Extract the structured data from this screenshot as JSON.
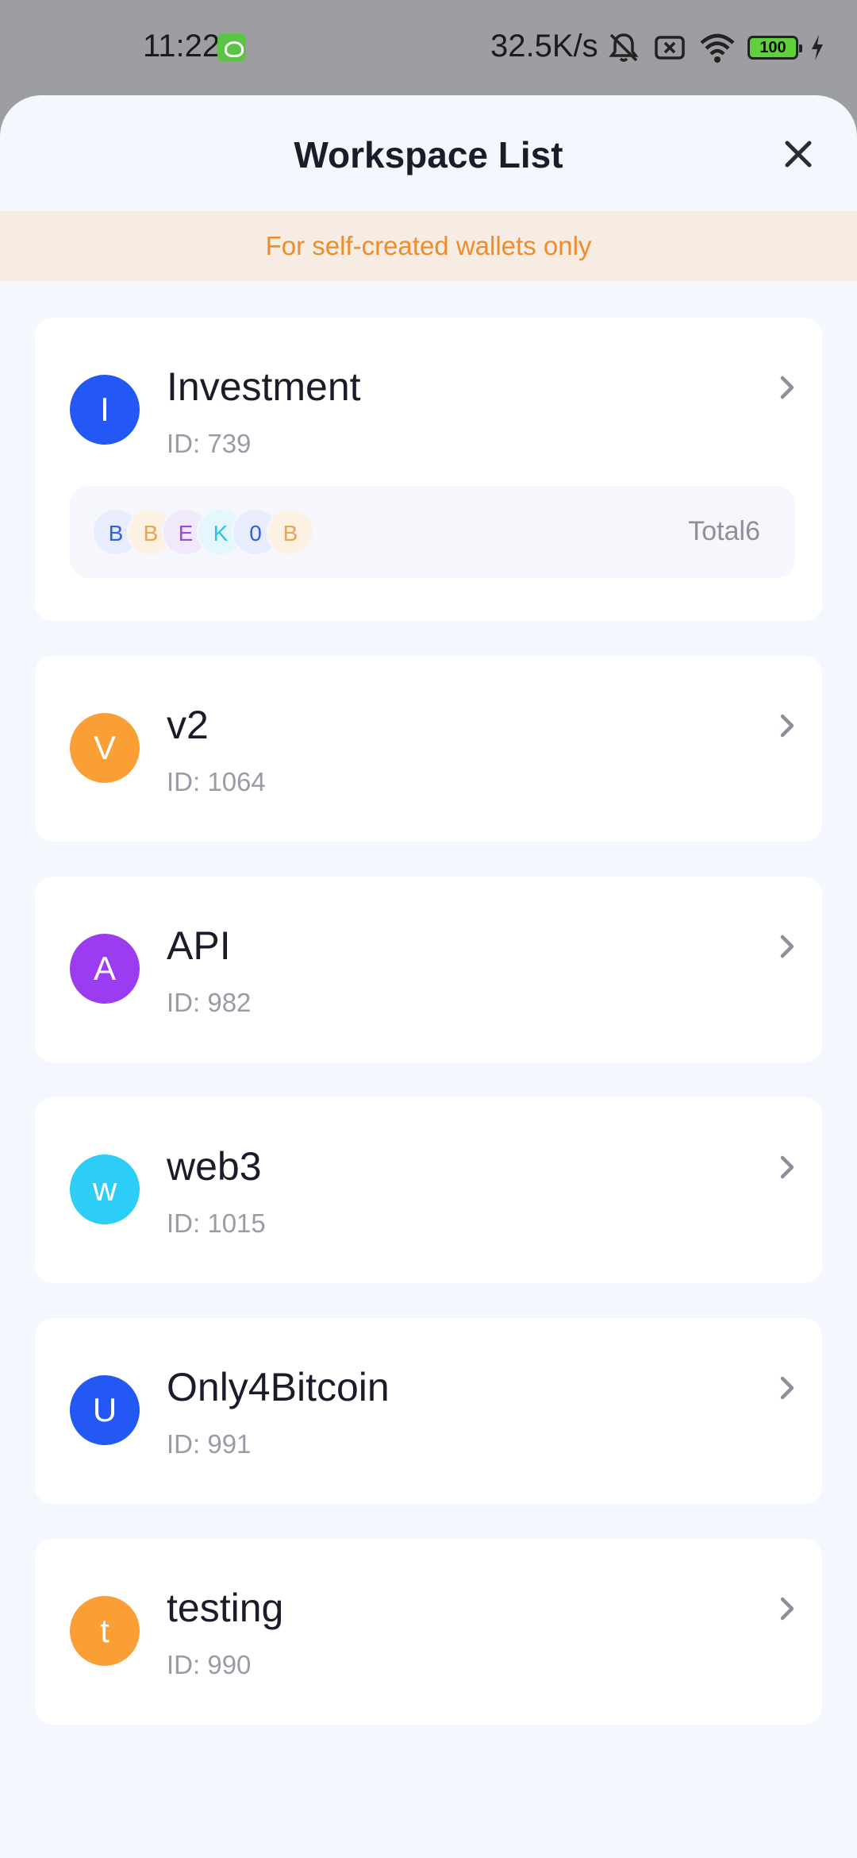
{
  "status_bar": {
    "time": "11:22",
    "speed": "32.5K/s",
    "battery": "100"
  },
  "sheet": {
    "title": "Workspace List",
    "notice": "For self-created wallets only"
  },
  "workspaces": [
    {
      "initial": "I",
      "name": "Investment",
      "id": "ID: 739",
      "color": "#2458f4",
      "wallets": {
        "coins": [
          {
            "letter": "B",
            "fg": "#2e5fe6",
            "bg": "#e7edfc"
          },
          {
            "letter": "B",
            "fg": "#f0a24a",
            "bg": "#fdf1e4"
          },
          {
            "letter": "E",
            "fg": "#9b4ad9",
            "bg": "#f1e8fb"
          },
          {
            "letter": "K",
            "fg": "#2cc4e6",
            "bg": "#e4f7fc"
          },
          {
            "letter": "0",
            "fg": "#2e5fe6",
            "bg": "#e7edfc"
          },
          {
            "letter": "B",
            "fg": "#f0a24a",
            "bg": "#fdf1e4"
          }
        ],
        "total": "Total6"
      }
    },
    {
      "initial": "V",
      "name": "v2",
      "id": "ID: 1064",
      "color": "#fa9e36"
    },
    {
      "initial": "A",
      "name": "API",
      "id": "ID: 982",
      "color": "#9b3cf0"
    },
    {
      "initial": "w",
      "name": "web3",
      "id": "ID: 1015",
      "color": "#2ccdf7"
    },
    {
      "initial": "U",
      "name": "Only4Bitcoin",
      "id": "ID: 991",
      "color": "#2458f4"
    },
    {
      "initial": "t",
      "name": "testing",
      "id": "ID: 990",
      "color": "#fa9e36"
    }
  ]
}
